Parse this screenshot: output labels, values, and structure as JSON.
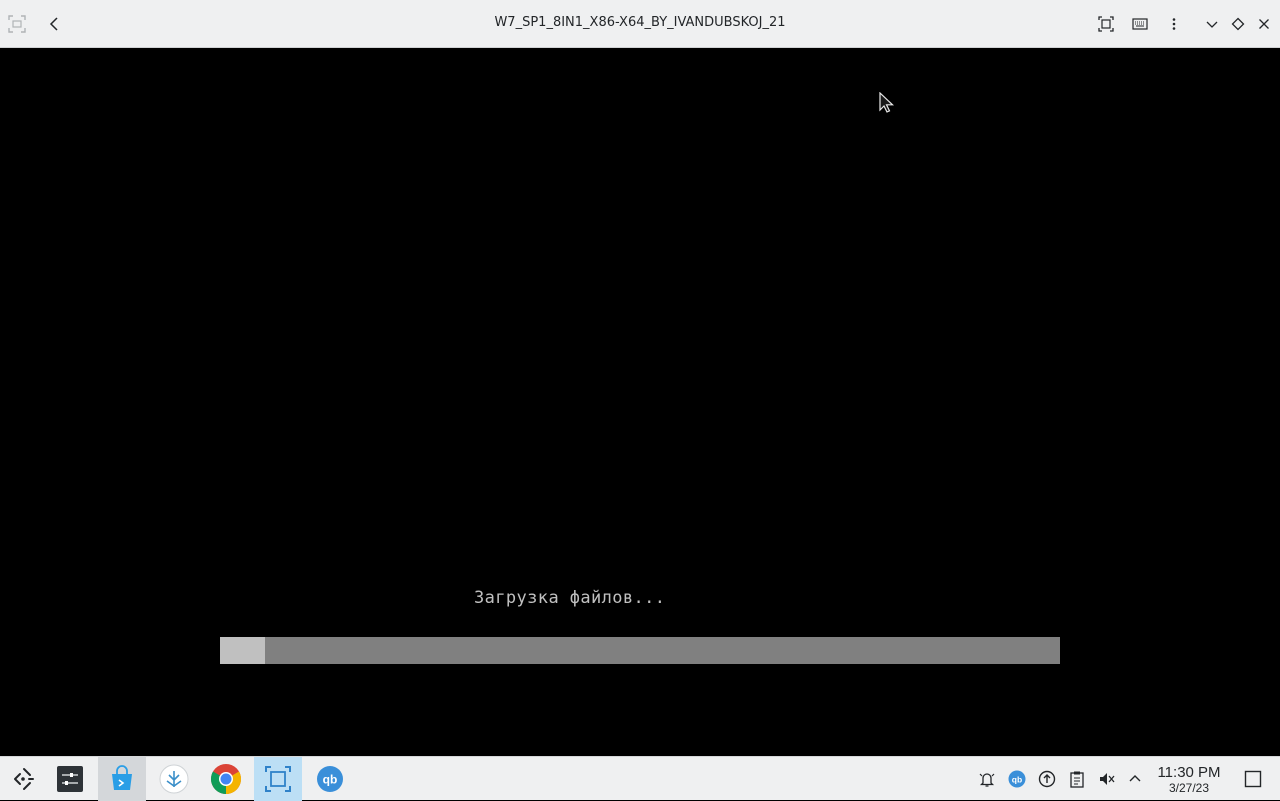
{
  "window": {
    "title": "W7_SP1_8IN1_X86-X64_BY_IVANDUBSKOJ_21",
    "app_icon": "screenshot-app-icon",
    "buttons": [
      "back-icon",
      "fullscreen-icon",
      "keyboard-icon",
      "menu-icon",
      "minimize-icon",
      "maximize-icon",
      "close-icon"
    ]
  },
  "vm": {
    "boot_message": "Загрузка файлов...",
    "progress_fraction": 0.053,
    "colors": {
      "background": "#000000",
      "text": "#c0c0c0",
      "track": "#808080",
      "fill": "#c0c0c0"
    }
  },
  "taskbar": {
    "launcher_icon": "app-launcher-icon",
    "tasks": [
      {
        "icon": "system-settings-icon"
      },
      {
        "icon": "discover-store-icon",
        "state": "active"
      },
      {
        "icon": "krita-app-icon"
      },
      {
        "icon": "chrome-icon"
      },
      {
        "icon": "virtual-machine-icon",
        "state": "highlight"
      },
      {
        "icon": "qbittorrent-icon"
      }
    ],
    "tray": [
      "notifications-icon",
      "qbittorrent-tray-icon",
      "updates-icon",
      "clipboard-icon",
      "volume-muted-icon",
      "tray-expand-icon"
    ],
    "clock": {
      "time": "11:30 PM",
      "date": "3/27/23"
    },
    "show_desktop_icon": "show-desktop-icon"
  }
}
